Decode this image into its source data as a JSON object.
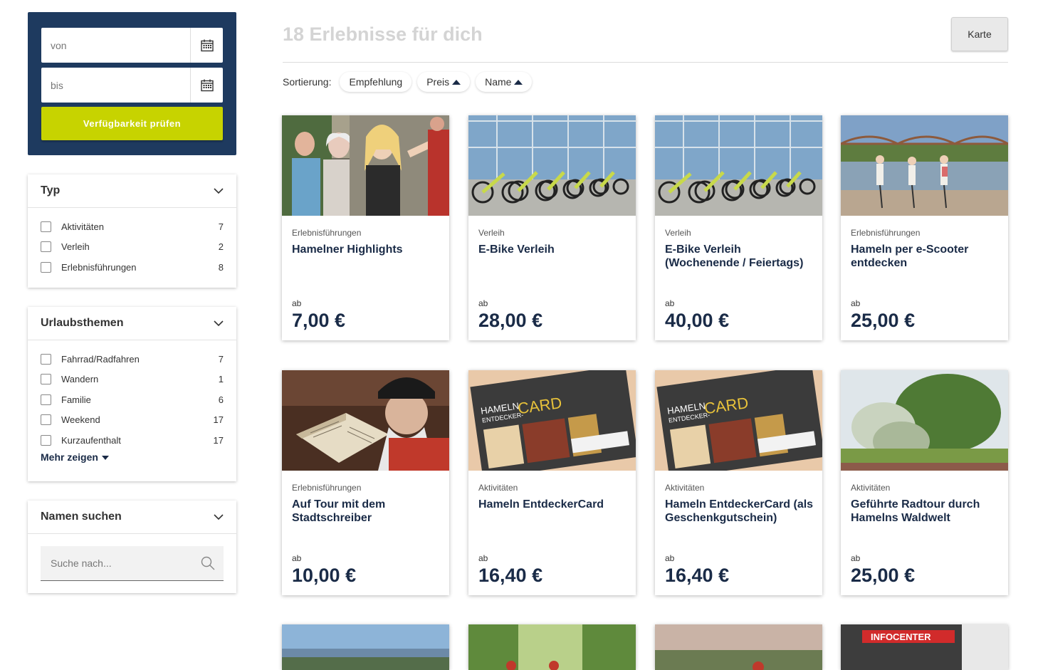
{
  "sidebar": {
    "date_from_placeholder": "von",
    "date_to_placeholder": "bis",
    "check_button": "Verfügbarkeit prüfen",
    "typ": {
      "title": "Typ",
      "items": [
        {
          "label": "Aktivitäten",
          "count": "7"
        },
        {
          "label": "Verleih",
          "count": "2"
        },
        {
          "label": "Erlebnisführungen",
          "count": "8"
        }
      ]
    },
    "themen": {
      "title": "Urlaubsthemen",
      "items": [
        {
          "label": "Fahrrad/Radfahren",
          "count": "7"
        },
        {
          "label": "Wandern",
          "count": "1"
        },
        {
          "label": "Familie",
          "count": "6"
        },
        {
          "label": "Weekend",
          "count": "17"
        },
        {
          "label": "Kurzaufenthalt",
          "count": "17"
        }
      ],
      "more": "Mehr zeigen"
    },
    "namesearch": {
      "title": "Namen suchen",
      "placeholder": "Suche nach..."
    }
  },
  "main": {
    "headline": "18 Erlebnisse für dich",
    "map_button": "Karte",
    "sort": {
      "label": "Sortierung:",
      "options": [
        "Empfehlung",
        "Preis",
        "Name"
      ]
    },
    "cards": [
      {
        "category": "Erlebnisführungen",
        "title": "Hamelner Highlights",
        "ab": "ab",
        "price": "7,00 €"
      },
      {
        "category": "Verleih",
        "title": "E-Bike Verleih",
        "ab": "ab",
        "price": "28,00 €"
      },
      {
        "category": "Verleih",
        "title": "E-Bike Verleih (Wochenende / Feiertags)",
        "ab": "ab",
        "price": "40,00 €"
      },
      {
        "category": "Erlebnisführungen",
        "title": "Hameln per e-Scooter entdecken",
        "ab": "ab",
        "price": "25,00 €"
      },
      {
        "category": "Erlebnisführungen",
        "title": "Auf Tour mit dem Stadtschreiber",
        "ab": "ab",
        "price": "10,00 €"
      },
      {
        "category": "Aktivitäten",
        "title": "Hameln EntdeckerCard",
        "ab": "ab",
        "price": "16,40 €"
      },
      {
        "category": "Aktivitäten",
        "title": "Hameln EntdeckerCard (als Geschenkgutschein)",
        "ab": "ab",
        "price": "16,40 €"
      },
      {
        "category": "Aktivitäten",
        "title": "Geführte Radtour durch Hamelns Waldwelt",
        "ab": "ab",
        "price": "25,00 €"
      }
    ],
    "image_texts": {
      "card_hameln": "HAMELN",
      "card_entdecker": "ENTDECKER-",
      "card_word": "CARD",
      "infocenter": "INFOCENTER"
    }
  },
  "colors": {
    "navy": "#1e3a5f",
    "lime": "#c7d300",
    "title_navy": "#1a2b47"
  }
}
